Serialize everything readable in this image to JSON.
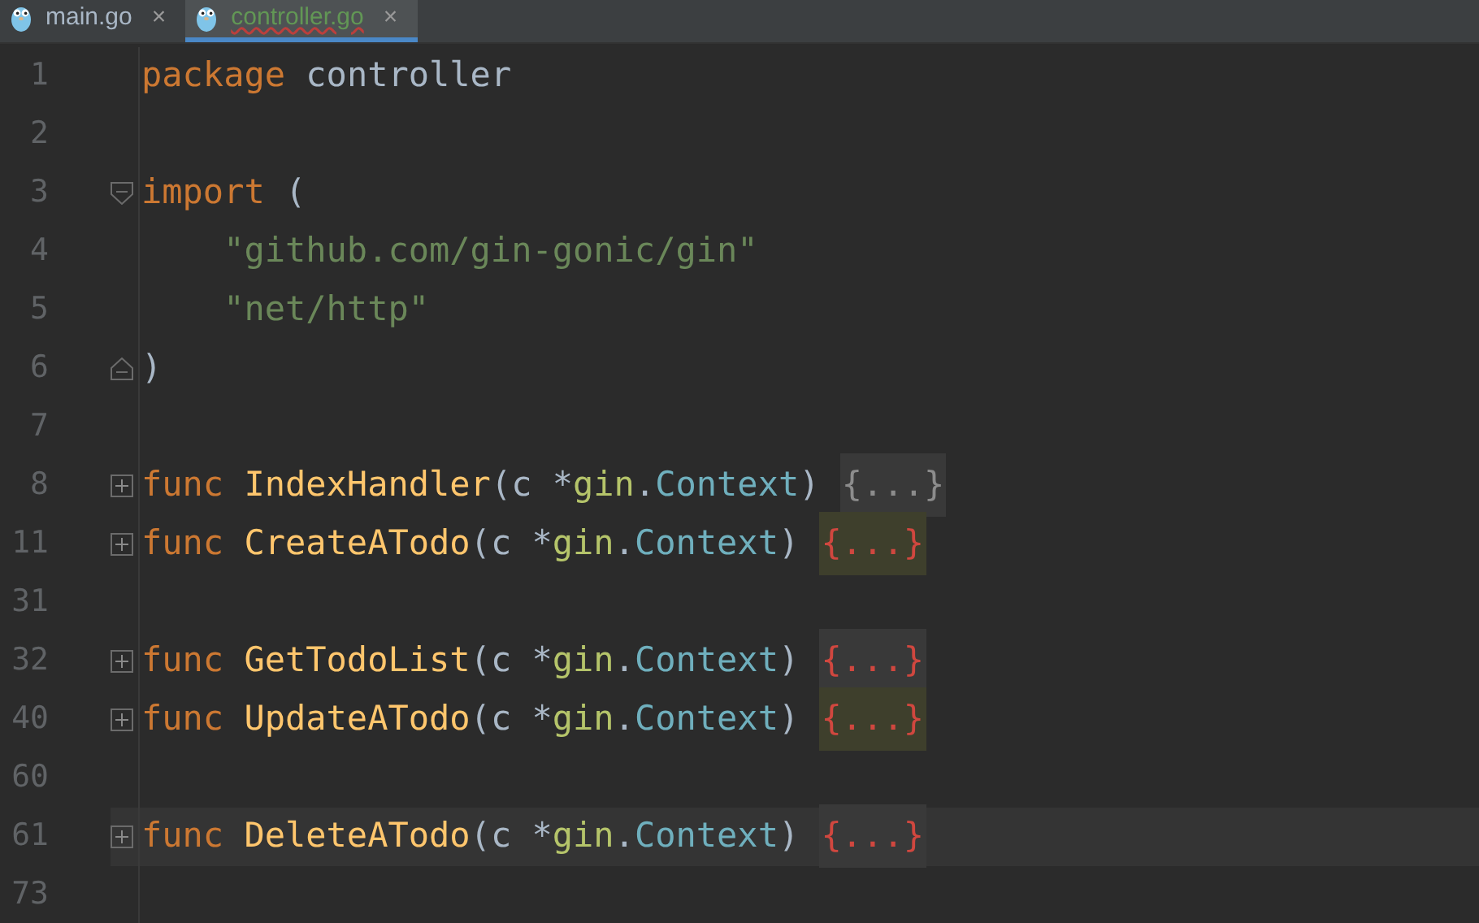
{
  "tabs": [
    {
      "label": "main.go",
      "close": "×",
      "selected": false,
      "has_error": false
    },
    {
      "label": "controller.go",
      "close": "×",
      "selected": true,
      "has_error": true
    }
  ],
  "lines": [
    {
      "number": "1",
      "tokens": [
        {
          "kind": "keyword",
          "text": "package"
        },
        {
          "kind": "plain",
          "text": "controller"
        }
      ]
    },
    {
      "number": "2"
    },
    {
      "number": "3",
      "fold_marker": {
        "kind": "start"
      },
      "tokens": [
        {
          "kind": "keyword",
          "text": "import"
        },
        {
          "kind": "plain",
          "text": "("
        }
      ]
    },
    {
      "number": "4",
      "indented": true,
      "tokens": [
        {
          "kind": "string",
          "text": "\"github.com/gin-gonic/gin\""
        }
      ]
    },
    {
      "number": "5",
      "indented": true,
      "tokens": [
        {
          "kind": "string",
          "text": "\"net/http\""
        }
      ]
    },
    {
      "number": "6",
      "fold_marker": {
        "kind": "end"
      },
      "tokens": [
        {
          "kind": "plain",
          "text": ")"
        }
      ]
    },
    {
      "number": "7"
    },
    {
      "number": "8",
      "fold_marker": {
        "kind": "collapsed"
      },
      "tokens": [
        {
          "kind": "keyword",
          "text": "func"
        },
        {
          "kind": "function",
          "text": "IndexHandler"
        },
        {
          "kind": "plain",
          "text": "(c *"
        },
        {
          "kind": "package",
          "text": "gin"
        },
        {
          "kind": "plain",
          "text": "."
        },
        {
          "kind": "type",
          "text": "Context"
        },
        {
          "kind": "plain",
          "text": ")"
        },
        {
          "kind": "folded",
          "text": "{...}",
          "error": false,
          "highlighted": false
        }
      ]
    },
    {
      "number": "11",
      "fold_marker": {
        "kind": "collapsed"
      },
      "tokens": [
        {
          "kind": "keyword",
          "text": "func"
        },
        {
          "kind": "function",
          "text": "CreateATodo"
        },
        {
          "kind": "plain",
          "text": "(c *"
        },
        {
          "kind": "package",
          "text": "gin"
        },
        {
          "kind": "plain",
          "text": "."
        },
        {
          "kind": "type",
          "text": "Context"
        },
        {
          "kind": "plain",
          "text": ")"
        },
        {
          "kind": "folded",
          "text": "{...}",
          "error": true,
          "highlighted": true
        }
      ]
    },
    {
      "number": "31"
    },
    {
      "number": "32",
      "fold_marker": {
        "kind": "collapsed"
      },
      "tokens": [
        {
          "kind": "keyword",
          "text": "func"
        },
        {
          "kind": "function",
          "text": "GetTodoList"
        },
        {
          "kind": "plain",
          "text": "(c *"
        },
        {
          "kind": "package",
          "text": "gin"
        },
        {
          "kind": "plain",
          "text": "."
        },
        {
          "kind": "type",
          "text": "Context"
        },
        {
          "kind": "plain",
          "text": ")"
        },
        {
          "kind": "folded",
          "text": "{...}",
          "error": true,
          "highlighted": false
        }
      ]
    },
    {
      "number": "40",
      "fold_marker": {
        "kind": "collapsed"
      },
      "tokens": [
        {
          "kind": "keyword",
          "text": "func"
        },
        {
          "kind": "function",
          "text": "UpdateATodo"
        },
        {
          "kind": "plain",
          "text": "(c *"
        },
        {
          "kind": "package",
          "text": "gin"
        },
        {
          "kind": "plain",
          "text": "."
        },
        {
          "kind": "type",
          "text": "Context"
        },
        {
          "kind": "plain",
          "text": ")"
        },
        {
          "kind": "folded",
          "text": "{...}",
          "error": true,
          "highlighted": true
        }
      ]
    },
    {
      "number": "60"
    },
    {
      "number": "61",
      "current": true,
      "fold_marker": {
        "kind": "collapsed"
      },
      "tokens": [
        {
          "kind": "keyword",
          "text": "func"
        },
        {
          "kind": "function",
          "text": "DeleteATodo"
        },
        {
          "kind": "plain",
          "text": "(c *"
        },
        {
          "kind": "package",
          "text": "gin"
        },
        {
          "kind": "plain",
          "text": "."
        },
        {
          "kind": "type",
          "text": "Context"
        },
        {
          "kind": "plain",
          "text": ")"
        },
        {
          "kind": "folded",
          "text": "{...}",
          "error": true,
          "highlighted": false
        }
      ]
    },
    {
      "number": "73"
    }
  ]
}
